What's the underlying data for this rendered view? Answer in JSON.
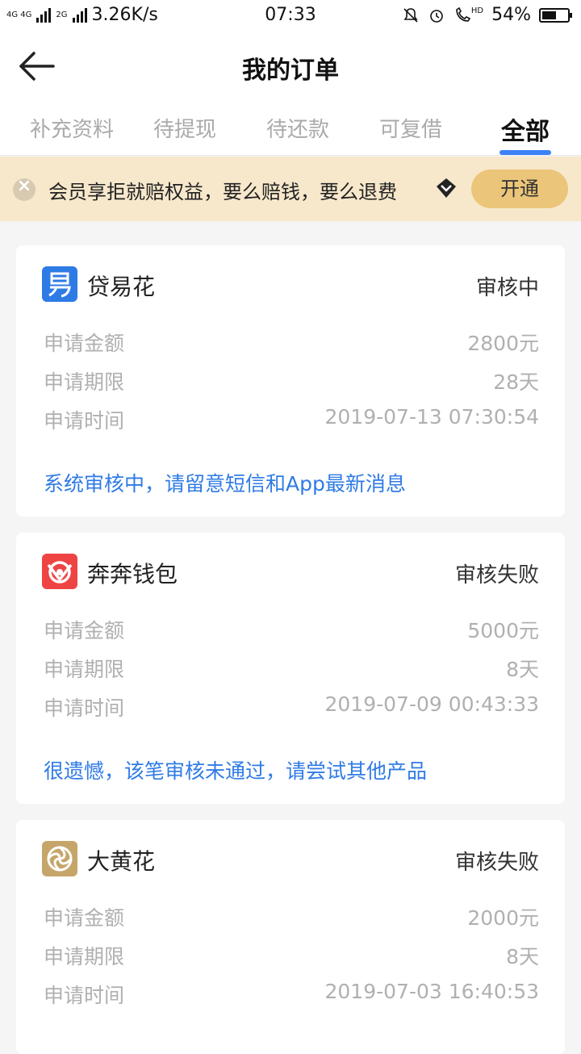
{
  "status_bar": {
    "network": "4G 4G",
    "network2": "2G",
    "speed": "3.26K/s",
    "time": "07:33",
    "hd": "HD",
    "battery": "54%"
  },
  "header": {
    "title": "我的订单"
  },
  "tabs": [
    {
      "label": "补充资料"
    },
    {
      "label": "待提现"
    },
    {
      "label": "待还款"
    },
    {
      "label": "可复借"
    },
    {
      "label": "全部"
    }
  ],
  "banner": {
    "text": "会员享拒就赔权益，要么赔钱，要么退费",
    "button": "开通"
  },
  "orders": [
    {
      "name": "贷易花",
      "status": "审核中",
      "amount_label": "申请金额",
      "amount": "2800元",
      "term_label": "申请期限",
      "term": "28天",
      "time_label": "申请时间",
      "time": "2019-07-13 07:30:54",
      "note": "系统审核中，请留意短信和App最新消息"
    },
    {
      "name": "奔奔钱包",
      "status": "审核失败",
      "amount_label": "申请金额",
      "amount": "5000元",
      "term_label": "申请期限",
      "term": "8天",
      "time_label": "申请时间",
      "time": "2019-07-09 00:43:33",
      "note": "很遗憾，该笔审核未通过，请尝试其他产品"
    },
    {
      "name": "大黄花",
      "status": "审核失败",
      "amount_label": "申请金额",
      "amount": "2000元",
      "term_label": "申请期限",
      "term": "8天",
      "time_label": "申请时间",
      "time": "2019-07-03 16:40:53"
    }
  ],
  "colors": {
    "accent_blue": "#2f7be5",
    "banner_bg": "#f7e8cc",
    "button_gold": "#ebc579"
  }
}
